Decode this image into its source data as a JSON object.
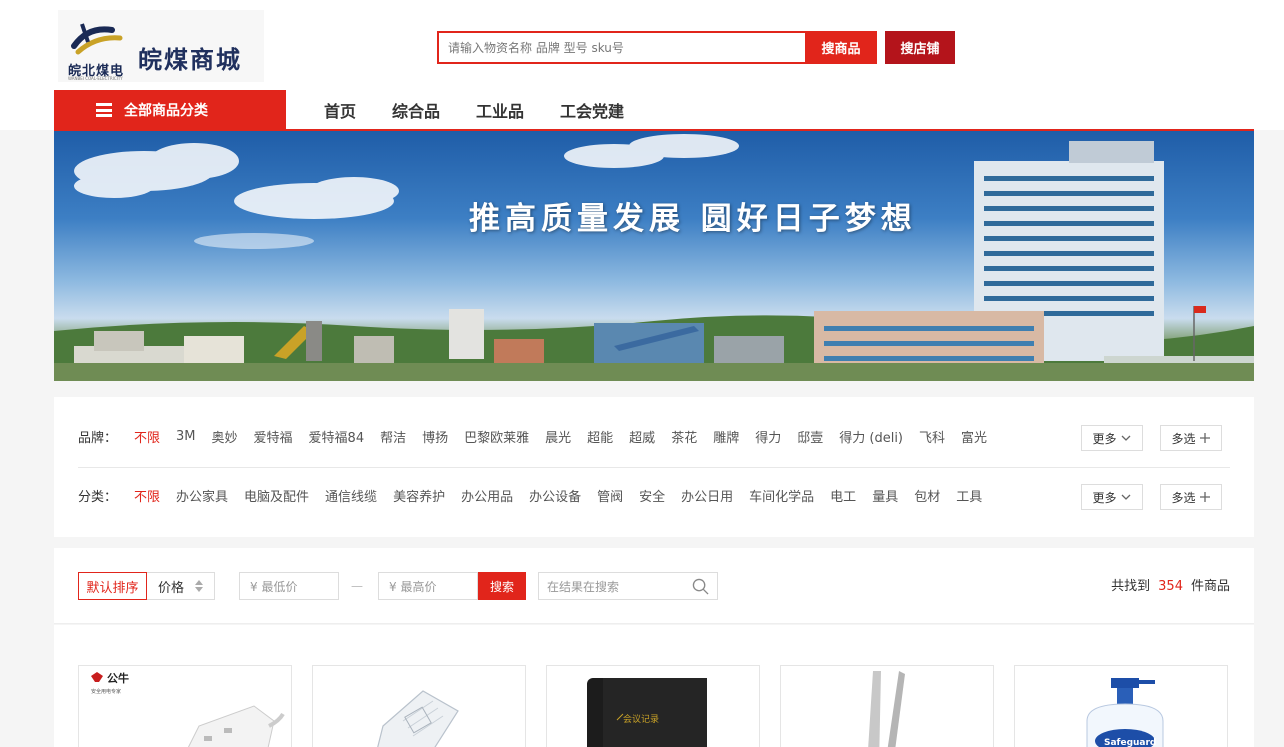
{
  "header": {
    "logo_text": "皖北煤电",
    "logo_fine_print": "WANBEI COAL-ELECTRICITY",
    "site_title": "皖煤商城",
    "search_placeholder": "请输入物资名称 品牌 型号 sku号",
    "search_goods_label": "搜商品",
    "search_shop_label": "搜店铺",
    "category_button_label": "全部商品分类",
    "nav": [
      "首页",
      "综合品",
      "工业品",
      "工会党建"
    ]
  },
  "banner": {
    "slogan": "推高质量发展  圆好日子梦想"
  },
  "filters": {
    "brand": {
      "label": "品牌：",
      "items": [
        "不限",
        "3M",
        "奥妙",
        "爱特福",
        "爱特福84",
        "帮洁",
        "博扬",
        "巴黎欧莱雅",
        "晨光",
        "超能",
        "超威",
        "茶花",
        "雕牌",
        "得力",
        "邸壹",
        "得力 (deli)",
        "飞科",
        "富光"
      ],
      "active": "不限",
      "more_label": "更多",
      "multi_label": "多选"
    },
    "category": {
      "label": "分类：",
      "items": [
        "不限",
        "办公家具",
        "电脑及配件",
        "通信线缆",
        "美容养护",
        "办公用品",
        "办公设备",
        "管阀",
        "安全",
        "办公日用",
        "车间化学品",
        "电工",
        "量具",
        "包材",
        "工具"
      ],
      "active": "不限",
      "more_label": "更多",
      "multi_label": "多选"
    }
  },
  "sortbar": {
    "default_sort_label": "默认排序",
    "price_label": "价格",
    "min_price_placeholder": "¥ 最低价",
    "dash": "—",
    "max_price_placeholder": "¥ 最高价",
    "price_search_label": "搜索",
    "result_search_placeholder": "在结果在搜索",
    "result_prefix": "共找到",
    "result_count": "354",
    "result_suffix": "件商品"
  },
  "products": {
    "first_brand_name": "公牛",
    "first_brand_tagline": "安全用电专家",
    "notebook_label": "会议记录",
    "bottle_label": "Safeguard"
  },
  "colors": {
    "accent": "#e1251b",
    "accent_dark": "#b4141b"
  }
}
